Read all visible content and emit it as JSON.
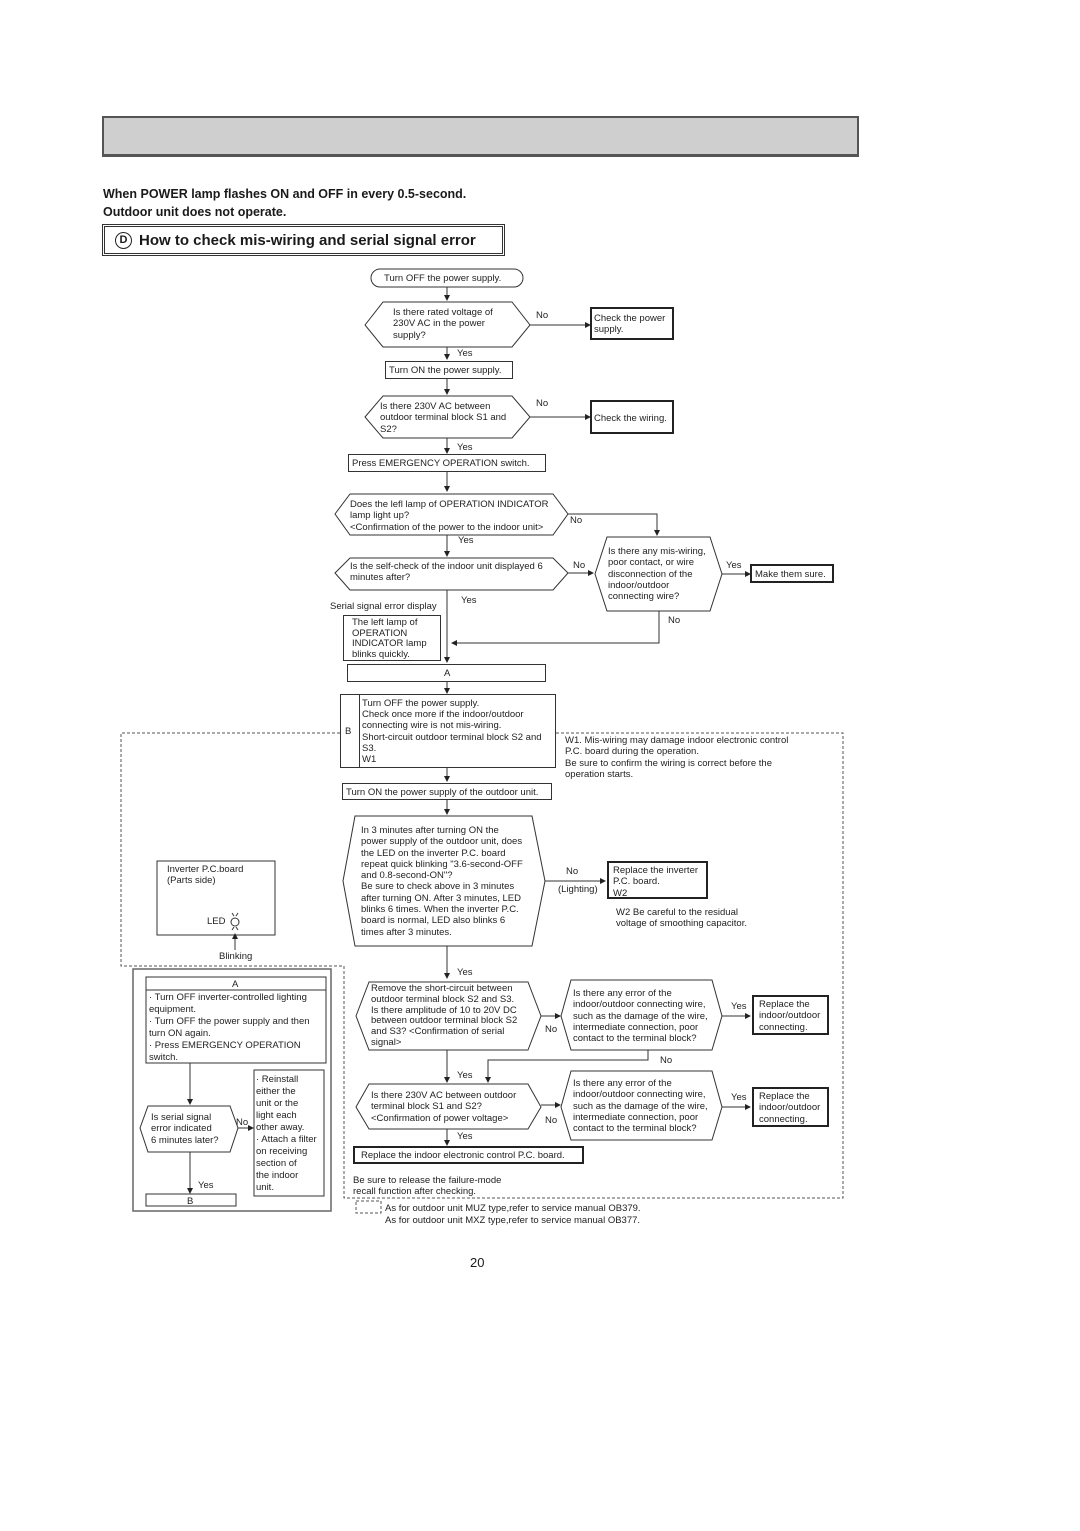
{
  "page": {
    "header_bar_text": "",
    "subtitle": "When POWER lamp flashes ON and OFF in every 0.5-second.\nOutdoor unit does not operate.",
    "section_letter": "D",
    "section_title": "How to check mis-wiring and serial signal error",
    "page_number": "20"
  },
  "flow": {
    "start": "Turn OFF the power supply.",
    "q_rated_voltage": "Is there rated voltage of\n230V AC in the power\nsupply?",
    "check_power": "Check the power\nsupply.",
    "turn_on": "Turn ON the power supply.",
    "q_230v_s1s2": "Is there 230V AC between\noutdoor terminal block S1 and\nS2?",
    "check_wiring": "Check the wiring.",
    "press_emergency": "Press EMERGENCY OPERATION switch.",
    "q_left_lamp": "Does the lefl lamp of OPERATION INDICATOR\nlamp light up?\n<Confirmation of the power to the indoor unit>",
    "q_self_check": "Is the self-check of the indoor unit displayed 6\nminutes after?",
    "q_miswiring": "Is there any mis-wiring,\npoor contact, or wire\ndisconnection of the\nindoor/outdoor\nconnecting wire?",
    "make_sure": "Make them sure.",
    "serial_error_label": "Serial signal error display",
    "left_lamp_blinks": "The left lamp of\nOPERATION\nINDICATOR lamp\nblinks quickly.",
    "connector_a": "A",
    "connector_b": "B",
    "step_b_text1": "Turn OFF the power supply.\nCheck once more if the indoor/outdoor\nconnecting wire is not mis-wiring.",
    "step_b_text2": "Short-circuit outdoor terminal block S2 and\nS3.\nW1",
    "turn_on_outdoor": "Turn ON the power supply of the outdoor unit.",
    "q_led_blinking": "In 3 minutes after turning ON the\npower supply of the outdoor unit, does\nthe LED on the inverter P.C. board\nrepeat quick blinking \"3.6-second-OFF\nand 0.8-second-ON\"?\nBe sure to check above in 3 minutes\nafter turning ON. After 3 minutes, LED\nblinks 6 times. When the inverter P.C.\nboard is normal, LED also blinks 6\ntimes after 3 minutes.",
    "replace_inverter": "Replace the inverter\nP.C. board.\nW2",
    "lighting_label": "(Lighting)",
    "q_amplitude": "Remove the short-circuit between\noutdoor terminal block S2 and S3.\nIs there amplitude of 10 to 20V DC\nbetween outdoor terminal block S2\nand S3?  <Confirmation of serial\nsignal>",
    "q_wire_error_1": "Is there any error of the\nindoor/outdoor connecting wire,\nsuch as the damage of the wire,\nintermediate connection, poor\ncontact to the terminal block?",
    "replace_connecting_1": "Replace the\nindoor/outdoor\nconnecting.",
    "q_power_voltage": "Is there 230V AC between outdoor\nterminal block S1 and S2?\n<Confirmation of power voltage>",
    "q_wire_error_2": "Is there any error of the\nindoor/outdoor connecting wire,\nsuch as the damage of the wire,\nintermediate connection, poor\ncontact to the terminal block?",
    "replace_connecting_2": "Replace the\nindoor/outdoor\nconnecting.",
    "replace_indoor_pcb": "Replace the indoor electronic control P.C. board.",
    "release_note": "Be sure to release the failure-mode\nrecall function after checking.",
    "yes": "Yes",
    "no": "No"
  },
  "notes": {
    "w1": "W1. Mis-wiring may damage indoor electronic control\n      P.C. board during the operation.\n      Be sure to confirm the wiring is correct before the\n       operation starts.",
    "w2": "W2 Be careful to the residual\n       voltage of smoothing capacitor.",
    "legend_muz": "As for outdoor unit MUZ type,refer to service manual OB379.",
    "legend_mxz": "As for outdoor unit MXZ type,refer to service manual OB377."
  },
  "inverter_board": {
    "title": "Inverter P.C.board\n(Parts side)",
    "led_label": "LED",
    "blinking_label": "Blinking"
  },
  "sub_flow_a": {
    "header": "A",
    "steps": "· Turn OFF inverter-controlled lighting\n  equipment.\n· Turn OFF the power supply and then\n  turn ON again.\n· Press EMERGENCY OPERATION\n  switch.",
    "question": "Is serial signal\nerror indicated\n6 minutes later?",
    "remedy": "· Reinstall\n  either the\n  unit or the\n  light each\n  other away.\n· Attach a filter\n  on receiving\n  section of\n  the indoor\n  unit.",
    "yes": "Yes",
    "no": "No",
    "footer": "B"
  }
}
